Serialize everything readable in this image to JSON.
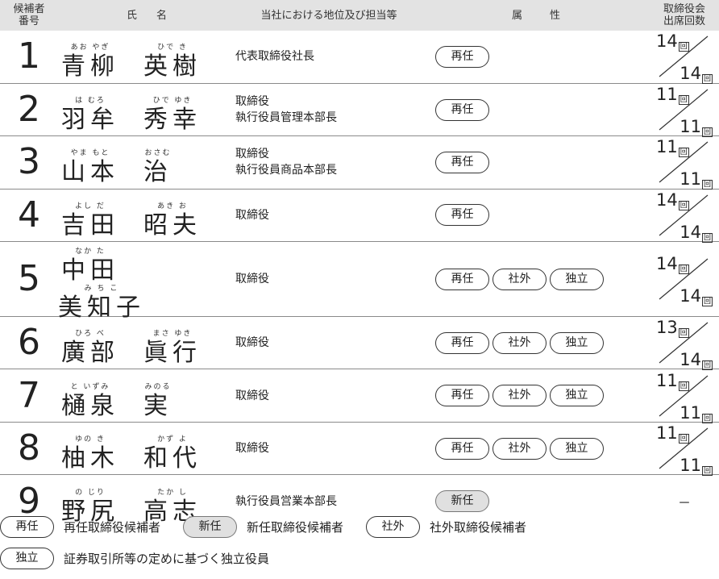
{
  "header": {
    "num": "候補者番号",
    "name": "氏名",
    "position": "当社における地位及び担当等",
    "attributes": "属性",
    "attendance": "取締役会出席回数"
  },
  "badge_labels": {
    "reappoint": "再任",
    "new": "新任",
    "outside": "社外",
    "independent": "独立"
  },
  "attendance_unit": "回",
  "candidates": [
    {
      "no": "1",
      "surname": "青柳",
      "surname_ruby": "あお やぎ",
      "given": "英樹",
      "given_ruby": "ひで き",
      "position": [
        "代表取締役社長"
      ],
      "attrs": [
        "再任"
      ],
      "attended": "14",
      "total": "14"
    },
    {
      "no": "2",
      "surname": "羽牟",
      "surname_ruby": "は むろ",
      "given": "秀幸",
      "given_ruby": "ひで ゆき",
      "position": [
        "取締役",
        "執行役員管理本部長"
      ],
      "attrs": [
        "再任"
      ],
      "attended": "11",
      "total": "11"
    },
    {
      "no": "3",
      "surname": "山本",
      "surname_ruby": "やま もと",
      "given": "治",
      "given_ruby": "おさむ",
      "position": [
        "取締役",
        "執行役員商品本部長"
      ],
      "attrs": [
        "再任"
      ],
      "attended": "11",
      "total": "11"
    },
    {
      "no": "4",
      "surname": "吉田",
      "surname_ruby": "よし だ",
      "given": "昭夫",
      "given_ruby": "あき お",
      "position": [
        "取締役"
      ],
      "attrs": [
        "再任"
      ],
      "attended": "14",
      "total": "14"
    },
    {
      "no": "5",
      "surname": "中田",
      "surname_ruby": "なか た",
      "given": "美知子",
      "given_ruby": "み ち こ",
      "position": [
        "取締役"
      ],
      "attrs": [
        "再任",
        "社外",
        "独立"
      ],
      "attended": "14",
      "total": "14"
    },
    {
      "no": "6",
      "surname": "廣部",
      "surname_ruby": "ひろ べ",
      "given": "眞行",
      "given_ruby": "まさ ゆき",
      "position": [
        "取締役"
      ],
      "attrs": [
        "再任",
        "社外",
        "独立"
      ],
      "attended": "13",
      "total": "14"
    },
    {
      "no": "7",
      "surname": "樋泉",
      "surname_ruby": "と いずみ",
      "given": "実",
      "given_ruby": "みのる",
      "position": [
        "取締役"
      ],
      "attrs": [
        "再任",
        "社外",
        "独立"
      ],
      "attended": "11",
      "total": "11"
    },
    {
      "no": "8",
      "surname": "柚木",
      "surname_ruby": "ゆの き",
      "given": "和代",
      "given_ruby": "かず よ",
      "position": [
        "取締役"
      ],
      "attrs": [
        "再任",
        "社外",
        "独立"
      ],
      "attended": "11",
      "total": "11"
    },
    {
      "no": "9",
      "surname": "野尻",
      "surname_ruby": "の じり",
      "given": "高志",
      "given_ruby": "たか し",
      "position": [
        "執行役員営業本部長"
      ],
      "attrs": [
        "新任"
      ],
      "attended": null,
      "total": null,
      "dash": "－"
    }
  ],
  "legend": [
    {
      "badge": "再任",
      "text": "再任取締役候補者",
      "style": "plain"
    },
    {
      "badge": "新任",
      "text": "新任取締役候補者",
      "style": "shaded"
    },
    {
      "badge": "社外",
      "text": "社外取締役候補者",
      "style": "plain"
    },
    {
      "badge": "独立",
      "text": "証券取引所等の定めに基づく独立役員",
      "style": "plain"
    }
  ],
  "colors": {
    "header_bg": "#e3e3e3",
    "new_badge_bg": "#e0e0e0",
    "text": "#222222",
    "rule": "#8a8a8a"
  }
}
